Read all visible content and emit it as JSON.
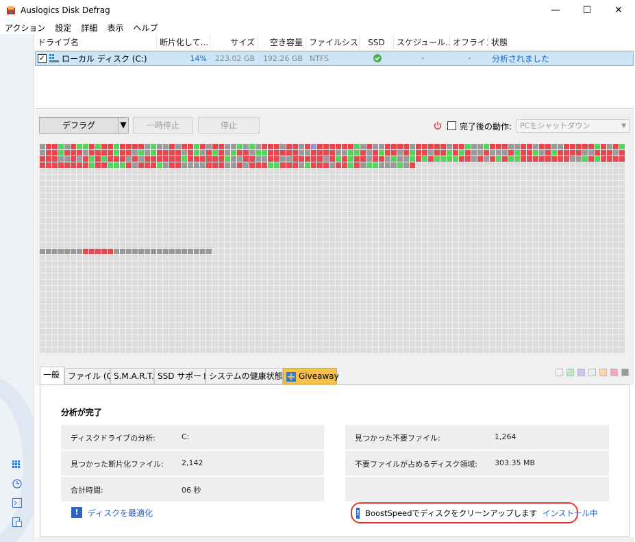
{
  "window": {
    "title": "Auslogics Disk Defrag"
  },
  "menu": [
    "アクション",
    "設定",
    "詳細",
    "表示",
    "ヘルプ"
  ],
  "drive_list": {
    "columns": [
      "ドライブ名",
      "断片化して...",
      "サイズ",
      "空き容量",
      "ファイルシス...",
      "SSD",
      "スケジュール...",
      "オフライン",
      "状態"
    ],
    "row": {
      "checked": true,
      "name": "ローカル ディスク (C:)",
      "fragmented": "14%",
      "size": "223.02 GB",
      "free": "192.26 GB",
      "fs": "NTFS",
      "status": "分析されました"
    }
  },
  "toolbar": {
    "defrag": "デフラグ",
    "pause": "一時停止",
    "stop": "停止",
    "after_label": "完了後の動作:",
    "after_value": "PCをシャットダウン"
  },
  "colors": {
    "fragmented": "#e8474f",
    "free": "#dcdcdc",
    "used": "#9a9a9a",
    "defragmented": "#55d35b",
    "mft": "#9b8fd6",
    "selection": "#cde6f7",
    "link": "#1f63c9",
    "accent_tab": "#f6c14a"
  },
  "tabs": [
    "一般",
    "ファイル (C:)",
    "S.M.A.R.T.",
    "SSD サポート",
    "システムの健康状態",
    "Giveaway"
  ],
  "legend": [
    "#f4f4f4",
    "#bfe9bf",
    "#cfc6ef",
    "#ededed",
    "#f7d8a8",
    "#f3a8ad",
    "#9a9a9a"
  ],
  "general": {
    "title": "分析が完了",
    "left": [
      {
        "k": "ディスクドライブの分析:",
        "v": "C:"
      },
      {
        "k": "見つかった断片化ファイル:",
        "v": "2,142"
      },
      {
        "k": "合計時間:",
        "v": "06 秒"
      }
    ],
    "right": [
      {
        "k": "見つかった不要ファイル:",
        "v": "1,264"
      },
      {
        "k": "不要ファイルが占めるディスク領域:",
        "v": "303.35 MB"
      },
      {
        "k": "",
        "v": ""
      }
    ],
    "optimize_link": "ディスクを最適化",
    "promo_text": "BoostSpeedでディスクをクリーンアップします",
    "promo_link": "インストール中"
  }
}
